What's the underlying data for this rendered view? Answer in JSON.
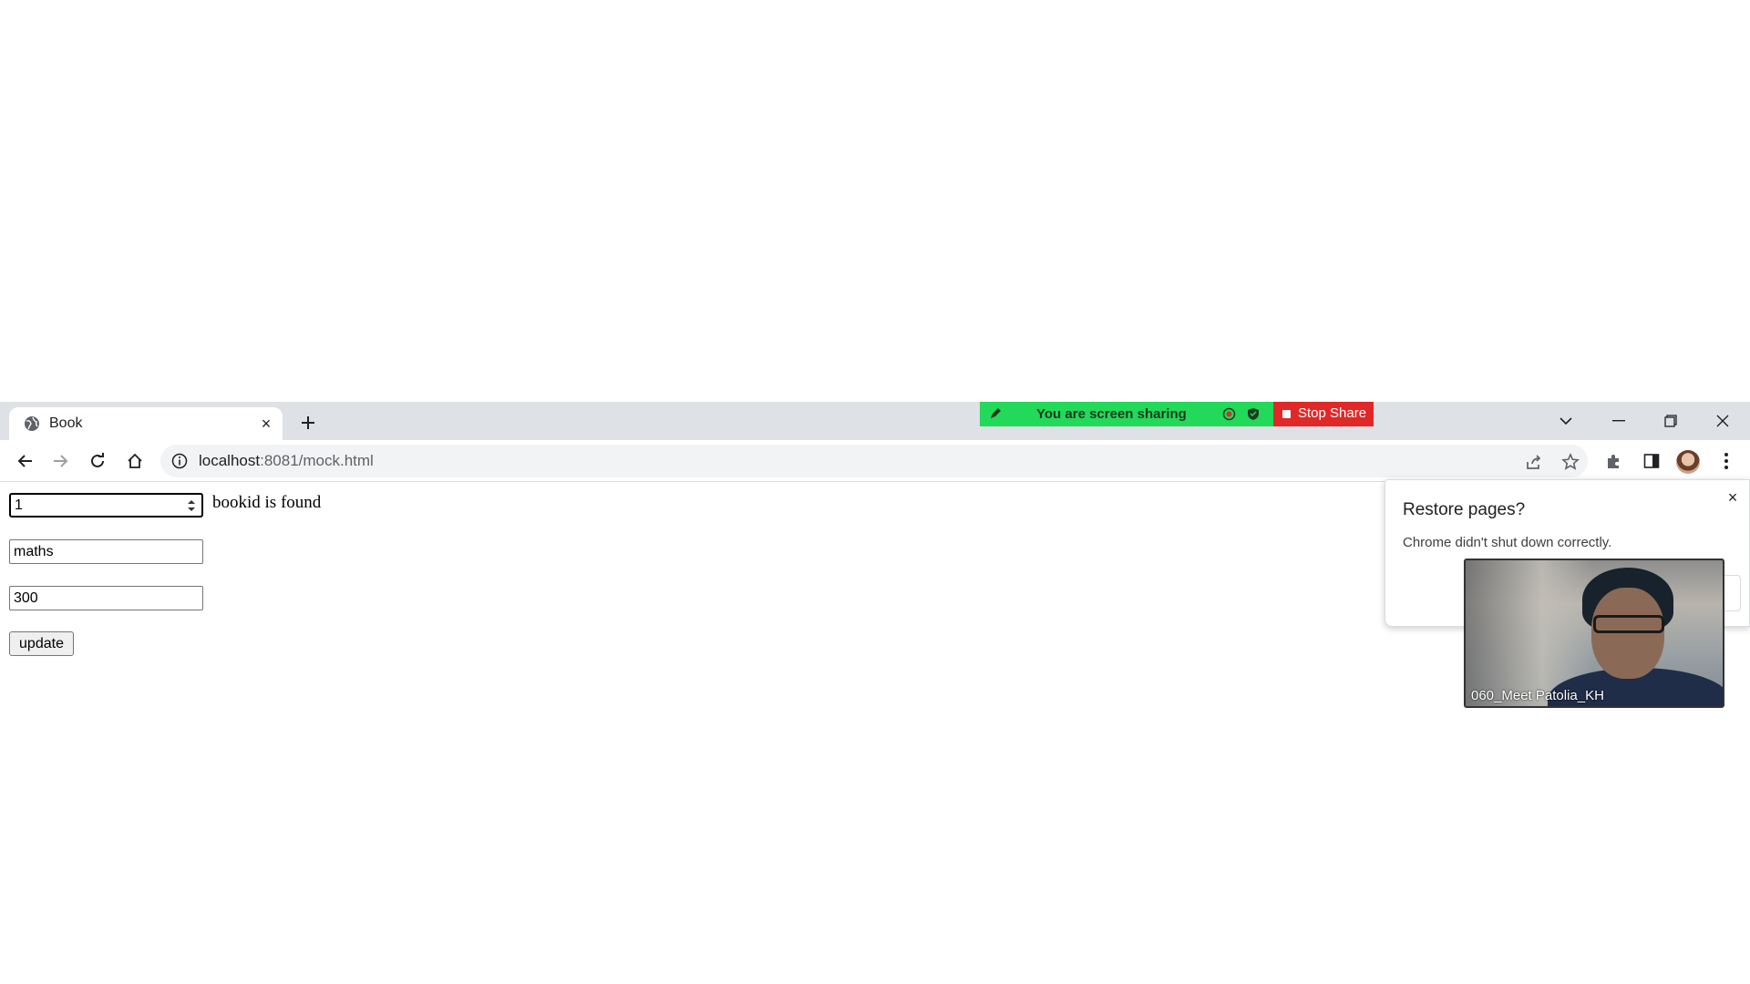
{
  "browser": {
    "tab": {
      "title": "Book",
      "favicon": "globe-icon",
      "close": "×"
    },
    "new_tab": "new-tab-icon",
    "address": {
      "host": "localhost",
      "path": ":8081/mock.html",
      "info_icon": "info-icon"
    },
    "toolbar_icons": [
      "back-icon",
      "forward-icon",
      "reload-icon",
      "home-icon",
      "share-icon",
      "star-icon",
      "extensions-icon",
      "side-panel-icon",
      "profile-avatar",
      "menu-icon"
    ]
  },
  "screen_share": {
    "status_text": "You are screen sharing",
    "stop_label": "Stop Share",
    "colors": {
      "bar": "#23d95a",
      "stop": "#e02828"
    }
  },
  "form": {
    "bookid_value": "1",
    "found_message": "bookid is found",
    "title_value": "maths",
    "price_value": "300",
    "update_label": "update"
  },
  "restore_dialog": {
    "title": "Restore pages?",
    "message": "Chrome didn't shut down correctly.",
    "close": "×"
  },
  "video": {
    "participant_name": "060_Meet Patolia_KH"
  }
}
